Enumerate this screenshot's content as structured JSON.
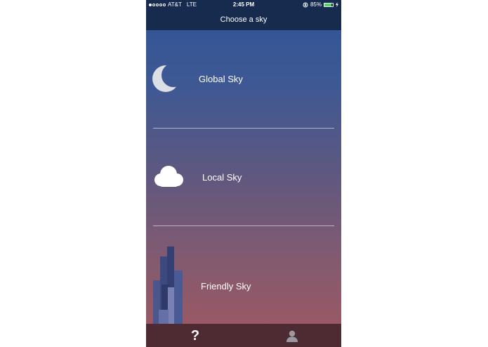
{
  "status_bar": {
    "carrier": "AT&T",
    "network": "LTE",
    "time": "2:45 PM",
    "battery_percent": "85%",
    "battery_level": 0.85,
    "signal_bars": 1
  },
  "nav": {
    "title": "Choose a sky"
  },
  "skies": [
    {
      "label": "Global Sky",
      "icon": "moon-icon"
    },
    {
      "label": "Local Sky",
      "icon": "cloud-icon"
    },
    {
      "label": "Friendly Sky",
      "icon": "skyline-icon"
    }
  ],
  "tab_bar": {
    "items": [
      {
        "icon": "help-icon",
        "glyph": "?"
      },
      {
        "icon": "profile-icon"
      }
    ]
  },
  "colors": {
    "nav_background": "#172b4f",
    "gradient_top": "#2d5597",
    "gradient_bottom": "#a05860",
    "tab_bar_background": "#4e2a32",
    "battery_fill": "#4cd964"
  }
}
